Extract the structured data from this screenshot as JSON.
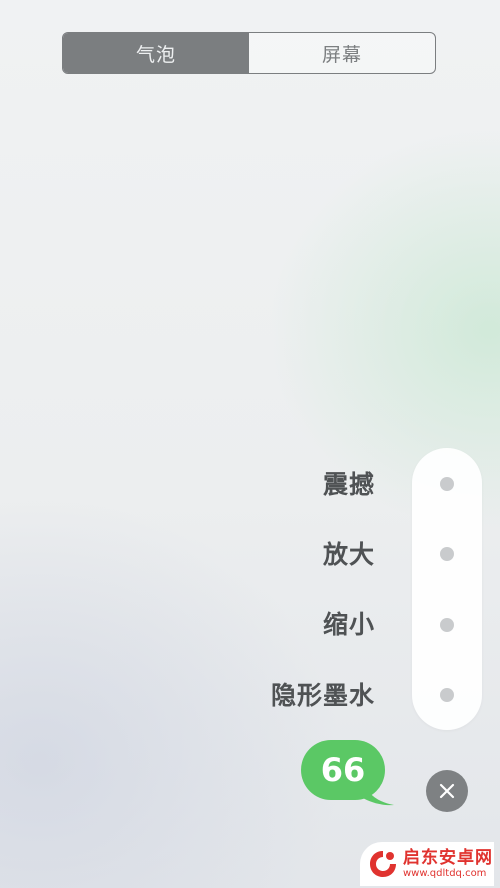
{
  "segmented": {
    "tabs": [
      {
        "label": "气泡",
        "selected": true
      },
      {
        "label": "屏幕",
        "selected": false
      }
    ]
  },
  "effects": [
    {
      "label": "震撼"
    },
    {
      "label": "放大"
    },
    {
      "label": "缩小"
    },
    {
      "label": "隐形墨水"
    }
  ],
  "message": {
    "text": "66",
    "bubble_color": "#5bc865"
  },
  "close_icon": "close-icon",
  "watermark": {
    "title": "启东安卓网",
    "url": "www.qdltdq.com",
    "color": "#e0332f"
  }
}
